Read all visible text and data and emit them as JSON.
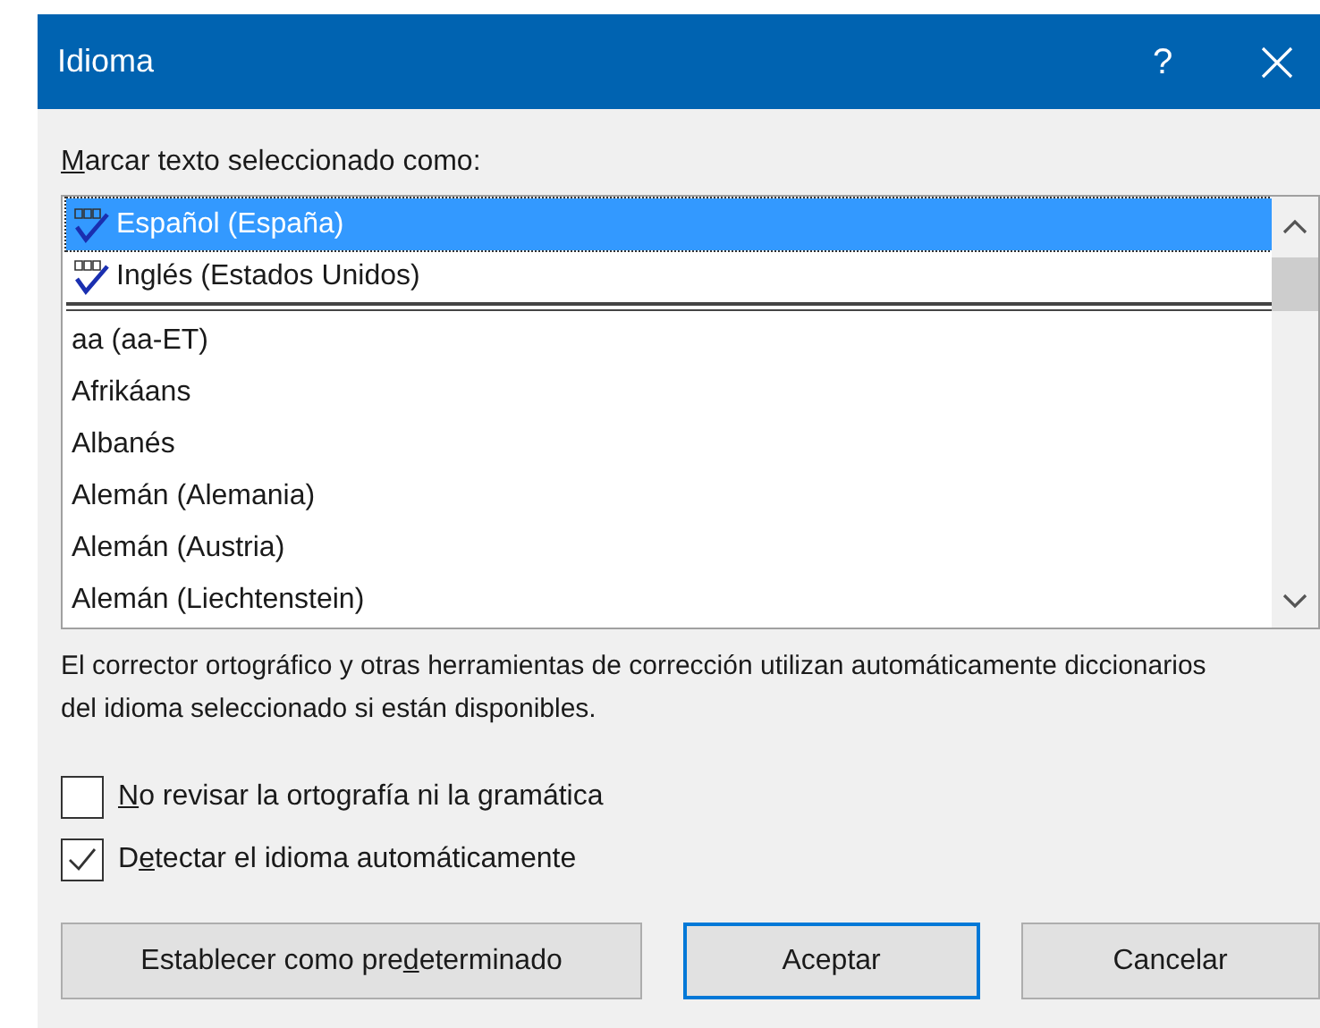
{
  "window": {
    "title": "Idioma",
    "help_button": "?"
  },
  "list_label": {
    "key": "M",
    "after": "arcar texto seleccionado como:"
  },
  "languages": [
    {
      "label": "Español (España)",
      "proofing": true,
      "selected": true
    },
    {
      "label": "Inglés (Estados Unidos)",
      "proofing": true,
      "selected": false
    },
    {
      "label": "aa (aa-ET)",
      "proofing": false,
      "selected": false
    },
    {
      "label": "Afrikáans",
      "proofing": false,
      "selected": false
    },
    {
      "label": "Albanés",
      "proofing": false,
      "selected": false
    },
    {
      "label": "Alemán (Alemania)",
      "proofing": false,
      "selected": false
    },
    {
      "label": "Alemán (Austria)",
      "proofing": false,
      "selected": false
    },
    {
      "label": "Alemán (Liechtenstein)",
      "proofing": false,
      "selected": false
    }
  ],
  "description": "El corrector ortográfico y otras herramientas de corrección utilizan automáticamente diccionarios del idioma seleccionado si están disponibles.",
  "options": [
    {
      "key": "N",
      "after": "o revisar la ortografía ni la gramática",
      "checked": false
    },
    {
      "before": "D",
      "key": "e",
      "after": "tectar el idioma automáticamente",
      "checked": true
    }
  ],
  "buttons": [
    {
      "before": "Establecer como pre",
      "key": "d",
      "after": "eterminado",
      "default": false
    },
    {
      "before": "Aceptar",
      "default": true
    },
    {
      "before": "Cancelar",
      "default": false
    }
  ]
}
